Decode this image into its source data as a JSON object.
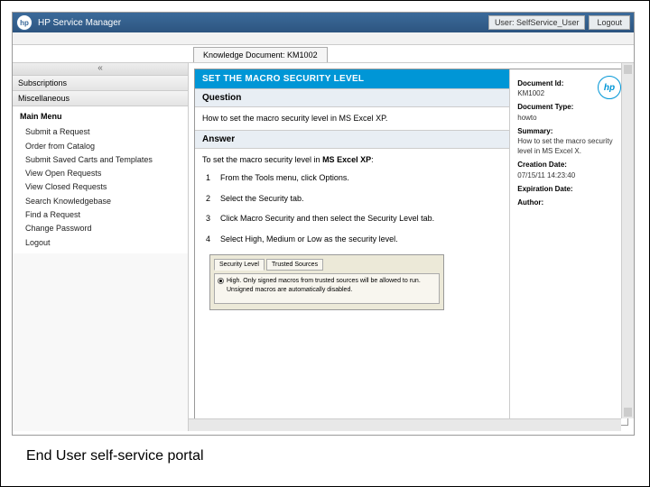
{
  "header": {
    "app_title": "HP Service Manager",
    "user_label": "User: SelfService_User",
    "logout_label": "Logout"
  },
  "tab": {
    "label": "Knowledge Document: KM1002"
  },
  "left_nav": {
    "collapse_hint": "«",
    "section_subscriptions": "Subscriptions",
    "section_miscellaneous": "Miscellaneous",
    "root": "Main Menu",
    "items": [
      "Submit a Request",
      "Order from Catalog",
      "Submit Saved Carts and Templates",
      "View Open Requests",
      "View Closed Requests",
      "Search Knowledgebase",
      "Find a Request",
      "Change Password",
      "Logout"
    ]
  },
  "document": {
    "title": "SET THE MACRO SECURITY LEVEL",
    "question_header": "Question",
    "question_text": "How to set the macro security level in MS Excel XP.",
    "answer_header": "Answer",
    "answer_intro_prefix": "To set the macro security level in ",
    "answer_intro_bold": "MS Excel XP",
    "answer_intro_suffix": ":",
    "steps": [
      {
        "n": "1",
        "text": "From the Tools menu, click Options."
      },
      {
        "n": "2",
        "text": "Select the Security tab."
      },
      {
        "n": "3",
        "text": "Click Macro Security and then select the Security Level tab."
      },
      {
        "n": "4",
        "text": "Select High, Medium or Low as the security level."
      }
    ],
    "inner_screenshot": {
      "tab1": "Security Level",
      "tab2": "Trusted Sources",
      "radio_text": "High. Only signed macros from trusted sources will be allowed to run. Unsigned macros are automatically disabled."
    }
  },
  "metadata": {
    "doc_id_label": "Document Id:",
    "doc_id_value": "KM1002",
    "doc_type_label": "Document Type:",
    "doc_type_value": "howto",
    "summary_label": "Summary:",
    "summary_value": "How to set the macro security level in MS Excel X.",
    "creation_label": "Creation Date:",
    "creation_value": "07/15/11 14:23:40",
    "expiration_label": "Expiration Date:",
    "expiration_value": "",
    "author_label": "Author:",
    "author_value": ""
  },
  "caption": "End User self-service portal"
}
